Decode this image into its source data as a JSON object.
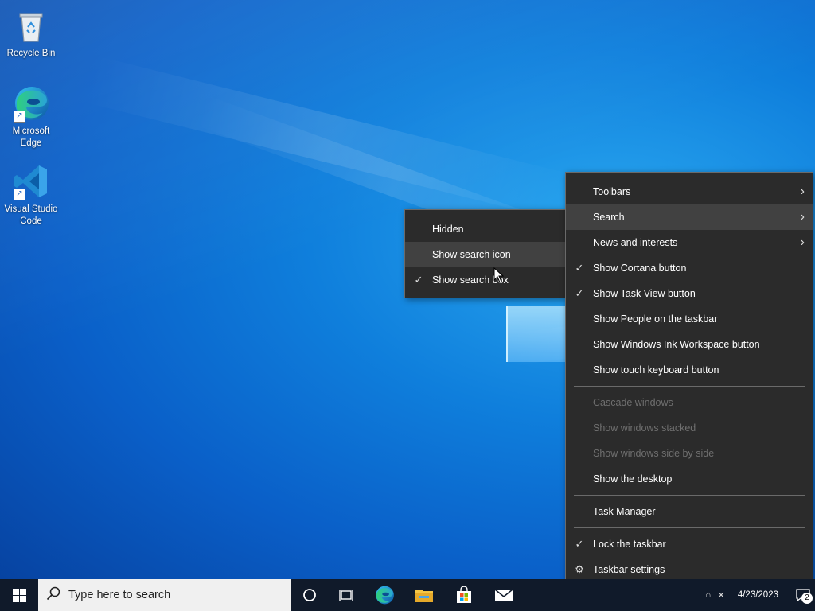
{
  "desktop": {
    "icons": [
      {
        "label": "Recycle Bin"
      },
      {
        "label": "Microsoft Edge"
      },
      {
        "label": "Visual Studio Code"
      }
    ]
  },
  "search_submenu": {
    "items": [
      {
        "label": "Hidden",
        "checked": false
      },
      {
        "label": "Show search icon",
        "checked": false,
        "hovered": true
      },
      {
        "label": "Show search box",
        "checked": true
      }
    ]
  },
  "taskbar_menu": {
    "items": {
      "toolbars": "Toolbars",
      "search": "Search",
      "news": "News and interests",
      "cortana": "Show Cortana button",
      "taskview": "Show Task View button",
      "people": "Show People on the taskbar",
      "ink": "Show Windows Ink Workspace button",
      "touch": "Show touch keyboard button",
      "cascade": "Cascade windows",
      "stacked": "Show windows stacked",
      "sidebyside": "Show windows side by side",
      "desktop": "Show the desktop",
      "taskmgr": "Task Manager",
      "lock": "Lock the taskbar",
      "settings": "Taskbar settings"
    },
    "check_glyph": "✓",
    "submenu_glyph": "›"
  },
  "taskbar": {
    "search_placeholder": "Type here to search",
    "date": "4/23/2023",
    "notification_count": "2"
  },
  "colors": {
    "menu_bg": "#2b2b2b",
    "menu_hover": "#414141",
    "taskbar_bg": "#101a2a"
  }
}
